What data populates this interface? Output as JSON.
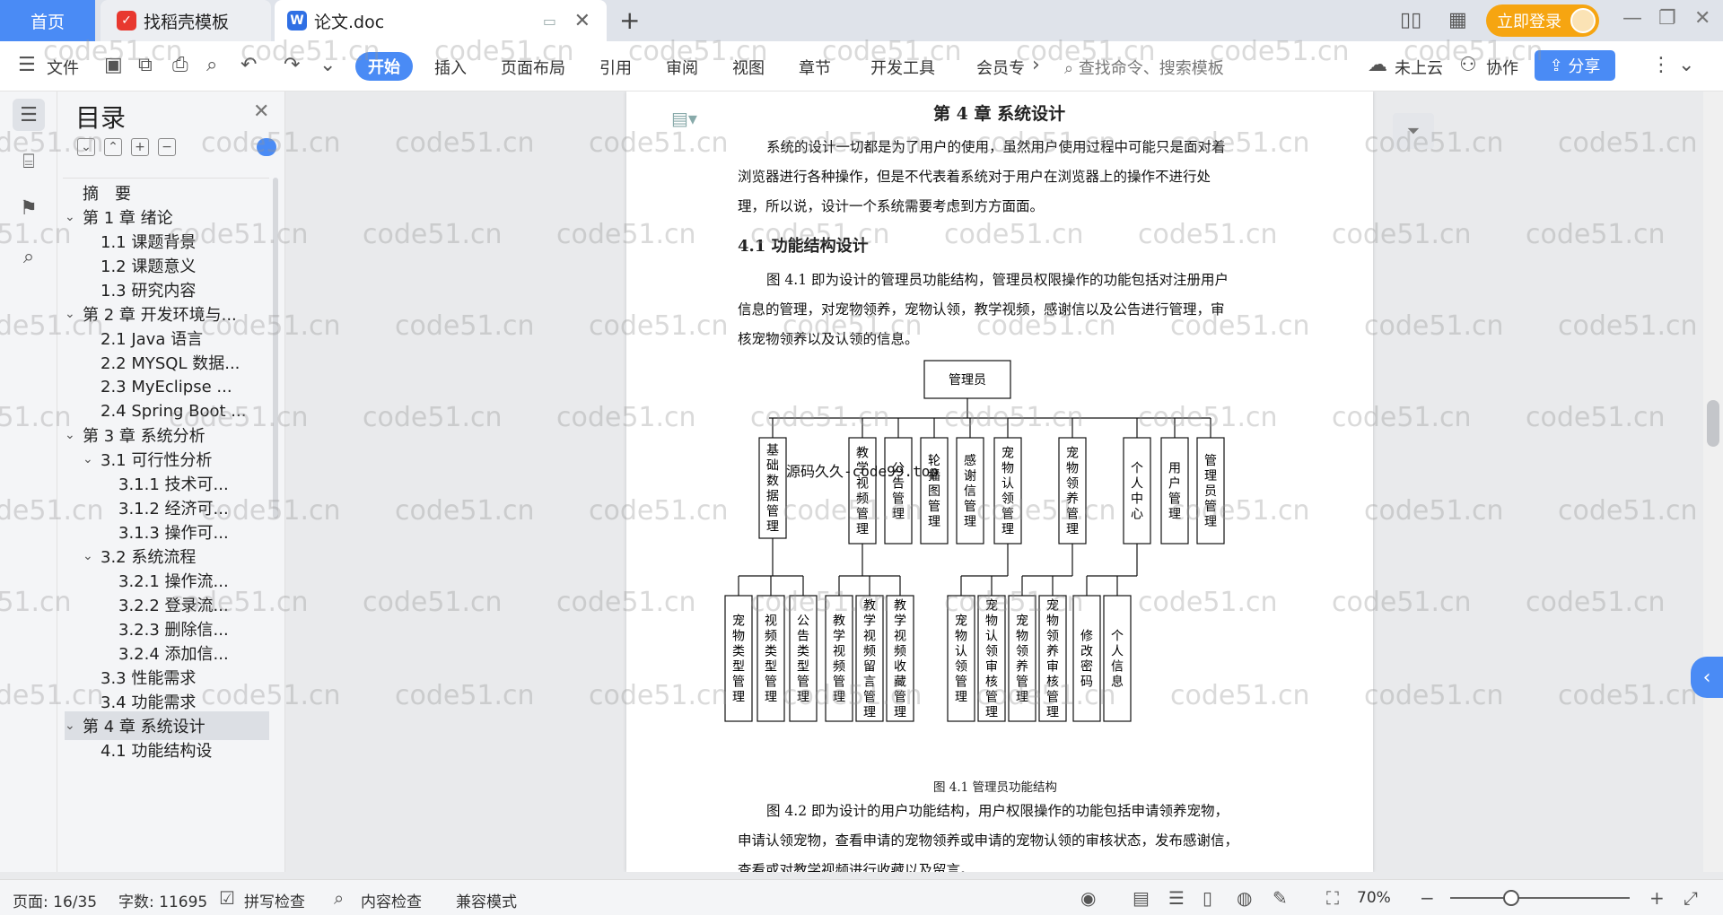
{
  "titlebar": {
    "home_tab": "首页",
    "template_tab": "找稻壳模板",
    "doc_tab": "论文.doc",
    "login_label": "立即登录"
  },
  "toolbar": {
    "file": "文件",
    "tabs": [
      "开始",
      "插入",
      "页面布局",
      "引用",
      "审阅",
      "视图",
      "章节",
      "开发工具",
      "会员专"
    ],
    "search_placeholder": "查找命令、搜索模板",
    "cloud": "未上云",
    "collab": "协作",
    "share": "分享"
  },
  "toc": {
    "title": "目录",
    "items": [
      {
        "label": "摘　要",
        "level": 1
      },
      {
        "label": "第 1 章  绪论",
        "level": 1
      },
      {
        "label": "1.1  课题背景",
        "level": 2
      },
      {
        "label": "1.2  课题意义",
        "level": 2
      },
      {
        "label": "1.3  研究内容",
        "level": 2
      },
      {
        "label": "第 2 章  开发环境与...",
        "level": 1
      },
      {
        "label": "2.1 Java 语言",
        "level": 2
      },
      {
        "label": "2.2 MYSQL 数据...",
        "level": 2
      },
      {
        "label": "2.3 MyEclipse ...",
        "level": 2
      },
      {
        "label": "2.4 Spring Boot ...",
        "level": 2
      },
      {
        "label": "第 3 章  系统分析",
        "level": 1
      },
      {
        "label": "3.1  可行性分析",
        "level": 2
      },
      {
        "label": "3.1.1  技术可...",
        "level": 3
      },
      {
        "label": "3.1.2  经济可...",
        "level": 3
      },
      {
        "label": "3.1.3  操作可...",
        "level": 3
      },
      {
        "label": "3.2  系统流程",
        "level": 2
      },
      {
        "label": "3.2.1  操作流...",
        "level": 3
      },
      {
        "label": "3.2.2  登录流...",
        "level": 3
      },
      {
        "label": "3.2.3  删除信...",
        "level": 3
      },
      {
        "label": "3.2.4  添加信...",
        "level": 3
      },
      {
        "label": "3.3  性能需求",
        "level": 2
      },
      {
        "label": "3.4  功能需求",
        "level": 2
      },
      {
        "label": "第 4 章  系统设计",
        "level": 1
      },
      {
        "label": "4.1  功能结构设",
        "level": 2
      }
    ]
  },
  "document": {
    "chapter_title": "第 4 章  系统设计",
    "intro": [
      "系统的设计一切都是为了用户的使用，虽然用户使用过程中可能只是面对着",
      "浏览器进行各种操作，但是不代表着系统对于用户在浏览器上的操作不进行处",
      "理，所以说，设计一个系统需要考虑到方方面面。"
    ],
    "section_title": "4.1  功能结构设计",
    "para1": [
      "图 4.1 即为设计的管理员功能结构，管理员权限操作的功能包括对注册用户",
      "信息的管理，对宠物领养，宠物认领，教学视频，感谢信以及公告进行管理，审",
      "核宠物领养以及认领的信息。"
    ],
    "figure_caption": "图 4.1  管理员功能结构",
    "para2": [
      "图 4.2 即为设计的用户功能结构，用户权限操作的功能包括申请领养宠物，",
      "申请认领宠物，查看申请的宠物领养或申请的宠物认领的审核状态，发布感谢信，",
      "查看或对教学视频进行收藏以及留言。"
    ],
    "overlay_text": "源码久久-code99.top",
    "watermark": "code51.cn"
  },
  "diagram": {
    "root": "管理员",
    "level1": [
      "基础数据管理",
      "教学视频管理",
      "公告管理",
      "轮播图管理",
      "感谢信管理",
      "宠物认领管理",
      "宠物领养管理",
      "个人中心",
      "用户管理",
      "管理员管理"
    ],
    "level2": [
      "宠物类型管理",
      "视频类型管理",
      "公告类型管理",
      "教学视频管理",
      "教学视频留言管理",
      "教学视频收藏管理",
      "宠物认领管理",
      "宠物认领审核管理",
      "宠物领养管理",
      "宠物领养审核管理",
      "修改密码",
      "个人信息"
    ]
  },
  "status": {
    "page": "页面: 16/35",
    "words": "字数: 11695",
    "spell": "拼写检查",
    "content_check": "内容检查",
    "compat": "兼容模式",
    "zoom": "70%"
  }
}
